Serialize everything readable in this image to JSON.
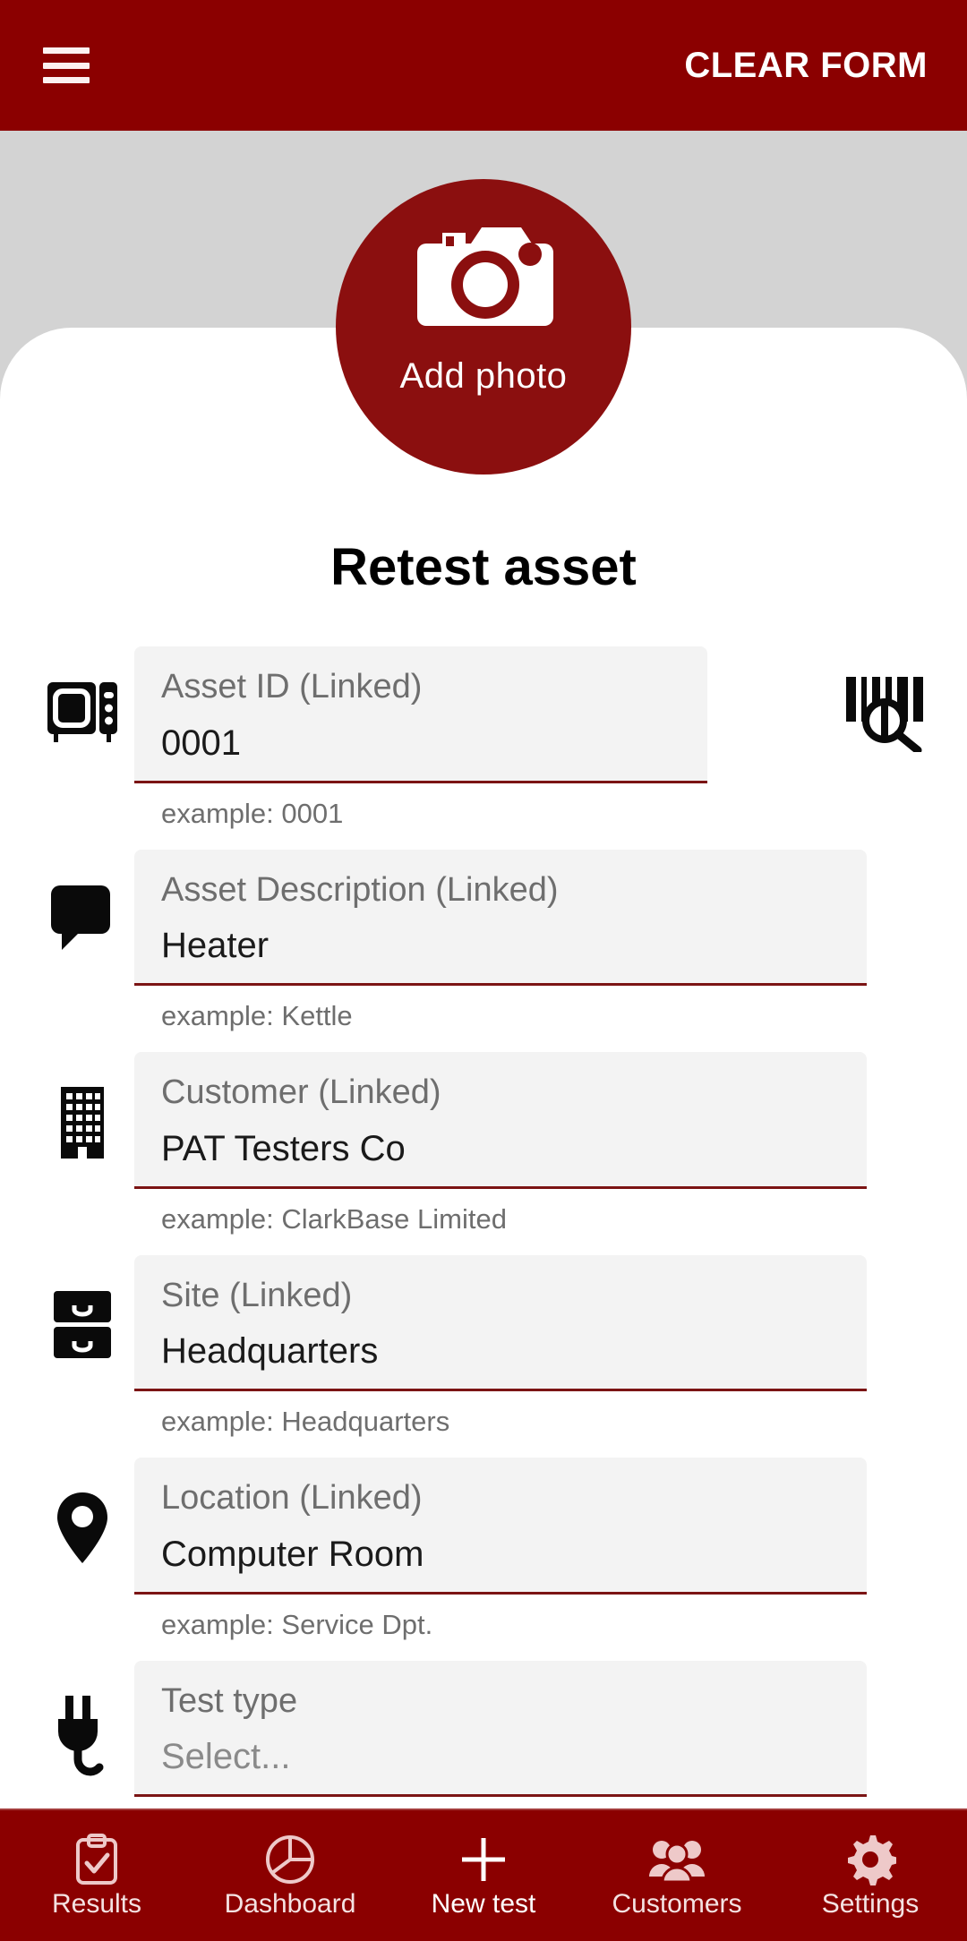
{
  "appbar": {
    "menu_icon": "hamburger-menu-icon",
    "clear_form_label": "CLEAR FORM",
    "background_color": "#8b0000"
  },
  "photo_badge": {
    "icon": "camera-icon",
    "label": "Add photo",
    "background_color": "#8b0f0f"
  },
  "page": {
    "title": "Retest asset",
    "background_color": "#d3d3d3",
    "sheet_color": "#ffffff",
    "accent_color": "#7b1414"
  },
  "form": {
    "fields": [
      {
        "icon": "microwave-icon",
        "label": "Asset ID (Linked)",
        "value": "0001",
        "example": "example: 0001",
        "has_scan": true,
        "scan_icon": "barcode-scan-icon",
        "is_placeholder": false
      },
      {
        "icon": "comment-bubble-icon",
        "label": "Asset Description (Linked)",
        "value": "Heater",
        "example": "example: Kettle",
        "has_scan": false,
        "is_placeholder": false
      },
      {
        "icon": "building-icon",
        "label": "Customer (Linked)",
        "value": "PAT Testers Co",
        "example": "example: ClarkBase Limited",
        "has_scan": false,
        "is_placeholder": false
      },
      {
        "icon": "filing-cabinet-icon",
        "label": "Site (Linked)",
        "value": "Headquarters",
        "example": "example: Headquarters",
        "has_scan": false,
        "is_placeholder": false
      },
      {
        "icon": "map-pin-icon",
        "label": "Location (Linked)",
        "value": "Computer Room",
        "example": "example: Service Dpt.",
        "has_scan": false,
        "is_placeholder": false
      },
      {
        "icon": "power-plug-icon",
        "label": "Test type",
        "value": "Select...",
        "example": "",
        "has_scan": false,
        "is_placeholder": true
      }
    ]
  },
  "bottom_nav": {
    "background_color": "#8b0000",
    "items": [
      {
        "icon": "clipboard-check-icon",
        "label": "Results",
        "active": false
      },
      {
        "icon": "pie-chart-icon",
        "label": "Dashboard",
        "active": false
      },
      {
        "icon": "plus-icon",
        "label": "New test",
        "active": true
      },
      {
        "icon": "people-icon",
        "label": "Customers",
        "active": false
      },
      {
        "icon": "gear-icon",
        "label": "Settings",
        "active": false
      }
    ]
  }
}
